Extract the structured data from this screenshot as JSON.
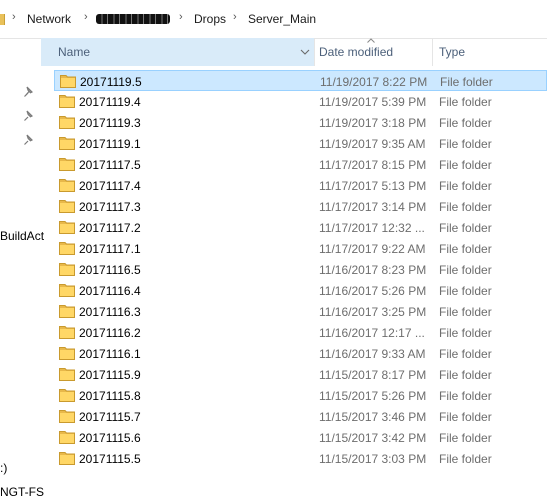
{
  "breadcrumb": {
    "items": [
      "Network",
      "Drops",
      "Server_Main"
    ],
    "separator": "›"
  },
  "nav": {
    "partial_labels": [
      "BuildAct",
      ":)",
      "NGT-FS"
    ]
  },
  "columns": {
    "name": "Name",
    "date_modified": "Date modified",
    "type": "Type"
  },
  "files": [
    {
      "name": "20171119.5",
      "date": "11/19/2017 8:22 PM",
      "type": "File folder",
      "selected": true
    },
    {
      "name": "20171119.4",
      "date": "11/19/2017 5:39 PM",
      "type": "File folder"
    },
    {
      "name": "20171119.3",
      "date": "11/19/2017 3:18 PM",
      "type": "File folder"
    },
    {
      "name": "20171119.1",
      "date": "11/19/2017 9:35 AM",
      "type": "File folder"
    },
    {
      "name": "20171117.5",
      "date": "11/17/2017 8:15 PM",
      "type": "File folder"
    },
    {
      "name": "20171117.4",
      "date": "11/17/2017 5:13 PM",
      "type": "File folder"
    },
    {
      "name": "20171117.3",
      "date": "11/17/2017 3:14 PM",
      "type": "File folder"
    },
    {
      "name": "20171117.2",
      "date": "11/17/2017 12:32 ...",
      "type": "File folder"
    },
    {
      "name": "20171117.1",
      "date": "11/17/2017 9:22 AM",
      "type": "File folder"
    },
    {
      "name": "20171116.5",
      "date": "11/16/2017 8:23 PM",
      "type": "File folder"
    },
    {
      "name": "20171116.4",
      "date": "11/16/2017 5:26 PM",
      "type": "File folder"
    },
    {
      "name": "20171116.3",
      "date": "11/16/2017 3:25 PM",
      "type": "File folder"
    },
    {
      "name": "20171116.2",
      "date": "11/16/2017 12:17 ...",
      "type": "File folder"
    },
    {
      "name": "20171116.1",
      "date": "11/16/2017 9:33 AM",
      "type": "File folder"
    },
    {
      "name": "20171115.9",
      "date": "11/15/2017 8:17 PM",
      "type": "File folder"
    },
    {
      "name": "20171115.8",
      "date": "11/15/2017 5:26 PM",
      "type": "File folder"
    },
    {
      "name": "20171115.7",
      "date": "11/15/2017 3:46 PM",
      "type": "File folder"
    },
    {
      "name": "20171115.6",
      "date": "11/15/2017 3:42 PM",
      "type": "File folder"
    },
    {
      "name": "20171115.5",
      "date": "11/15/2017 3:03 PM",
      "type": "File folder"
    }
  ],
  "colors": {
    "selection_fill": "#cce8ff",
    "selection_border": "#99d1ff",
    "header_highlight": "#d9ebf9",
    "folder_yellow": "#ffd766"
  },
  "icons": {
    "folder": "folder-icon",
    "pin": "pin-icon",
    "breadcrumb_separator": "chevron-right-icon",
    "column_menu": "chevron-down-icon"
  }
}
